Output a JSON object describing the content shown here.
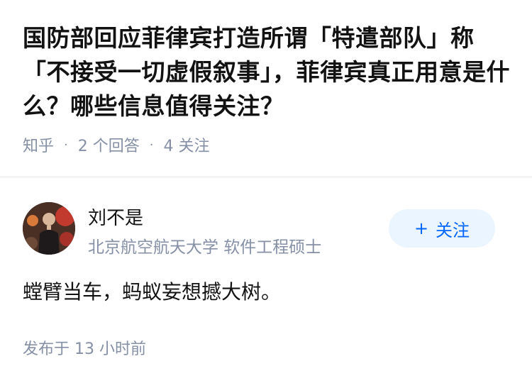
{
  "question": {
    "title": "国防部回应菲律宾打造所谓「特遣部队」称「不接受一切虚假叙事」，菲律宾真正用意是什么？哪些信息值得关注？",
    "source": "知乎",
    "separator": "·",
    "answer_count": "2 个回答",
    "follower_count": "4 关注"
  },
  "author": {
    "name": "刘不是",
    "bio": "北京航空航天大学 软件工程硕士",
    "follow_label": "关注",
    "follow_icon": "plus-icon"
  },
  "answer": {
    "text": "螳臂当车，蚂蚁妄想撼大树。",
    "published": "发布于 13 小时前"
  },
  "colors": {
    "accent": "#0066ff",
    "follow_bg": "#ebf5ff",
    "meta_text": "#8590a6",
    "title_text": "#121212"
  }
}
